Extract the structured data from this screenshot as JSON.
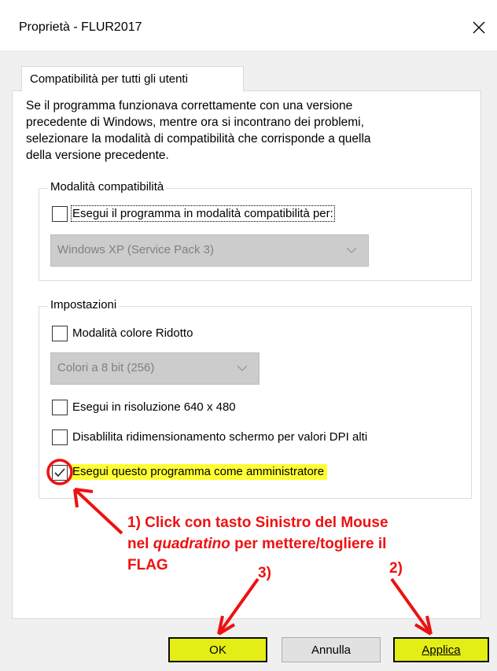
{
  "window": {
    "title": "Proprietà - FLUR2017",
    "close_icon": "×"
  },
  "tab": {
    "label": "Compatibilità per tutti gli utenti"
  },
  "intro_lines": [
    "Se il programma funzionava correttamente con una versione",
    "precedente di Windows, mentre ora si incontrano dei problemi,",
    "selezionare la modalità di compatibilità che corrisponde a quella",
    "della versione precedente."
  ],
  "compat_group": {
    "title": "Modalità compatibilità",
    "checkbox_label": "Esegui il programma in modalità compatibilità per:",
    "checked": false,
    "combo_value": "Windows XP (Service Pack 3)"
  },
  "settings_group": {
    "title": "Impostazioni",
    "reduced_color_label": "Modalità colore Ridotto",
    "reduced_color_checked": false,
    "color_combo_value": "Colori a 8 bit (256)",
    "res_label": "Esegui in risoluzione 640 x 480",
    "res_checked": false,
    "dpi_label": "Disablilita ridimensionamento schermo per valori DPI alti",
    "dpi_checked": false,
    "admin_label": "Esegui questo programma come amministratore",
    "admin_checked": true
  },
  "annotations": {
    "a1_line1": "1)  Click con tasto Sinistro del Mouse",
    "a1_line2_pre": "nel ",
    "a1_line2_em": "quadratino",
    "a1_line2_post": " per mettere/togliere il",
    "a1_line3": "FLAG",
    "a2": "2)",
    "a3": "3)"
  },
  "buttons": {
    "ok": "OK",
    "cancel": "Annulla",
    "apply": "Applica"
  },
  "colors": {
    "highlight": "#ffff33",
    "annotation": "#ee1111",
    "button_highlight": "#e4ee16"
  }
}
